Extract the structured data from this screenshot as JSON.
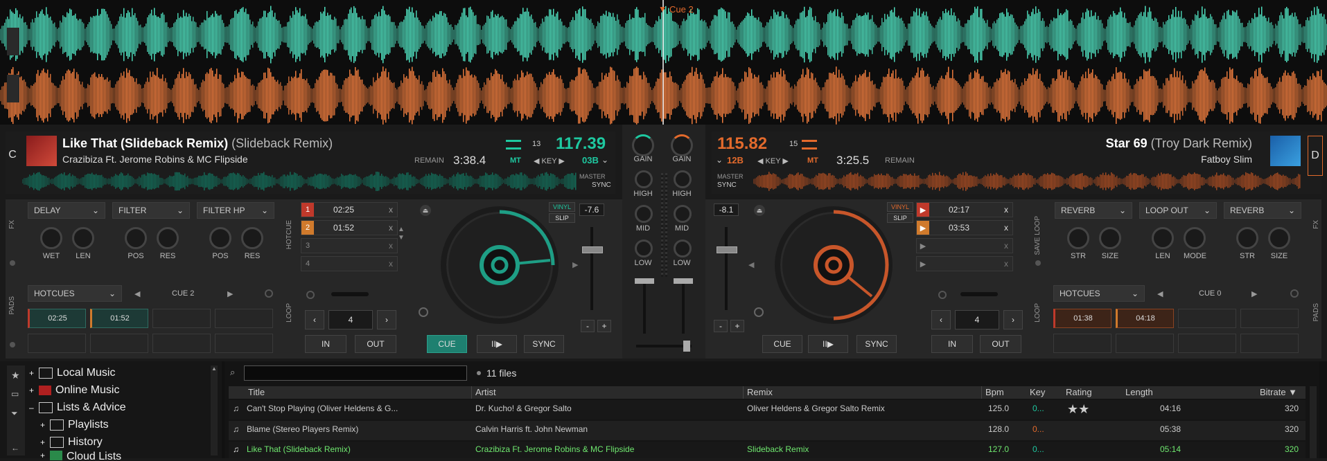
{
  "colors": {
    "deck_a": "#1ec8a0",
    "deck_b": "#e36a2c",
    "wave_a": "#4fe0bf",
    "wave_b": "#f07d3e",
    "green_text": "#6fe86f"
  },
  "waveform": {
    "cue_label": "Cue 2"
  },
  "deck_a": {
    "letter": "C",
    "title": "Like That (Slideback Remix)",
    "title_sub": "(Slideback Remix)",
    "artist": "Crazibiza Ft. Jerome Robins & MC Flipside",
    "pitch_count": "13",
    "bpm": "117.39",
    "remain_label": "REMAIN",
    "remain_time": "3:38.4",
    "mt": "MT",
    "key_label": "KEY",
    "key": "03B",
    "master": "MASTER",
    "sync": "SYNC",
    "pitch_val": "-7.6",
    "vinyl": "VINYL",
    "slip": "SLIP",
    "fx": [
      {
        "name": "DELAY",
        "knobs": [
          "WET",
          "LEN"
        ]
      },
      {
        "name": "FILTER",
        "knobs": [
          "POS",
          "RES"
        ]
      },
      {
        "name": "FILTER HP",
        "knobs": [
          "POS",
          "RES"
        ]
      }
    ],
    "fx_label": "FX",
    "hotcue_label": "HOTCUE",
    "hotcues": [
      {
        "num": "1",
        "time": "02:25",
        "x": "x"
      },
      {
        "num": "2",
        "time": "01:52",
        "x": "x"
      },
      {
        "num": "3",
        "time": "",
        "x": "x"
      },
      {
        "num": "4",
        "time": "",
        "x": "x"
      }
    ],
    "pads_label": "PADS",
    "pads_mode": "HOTCUES",
    "pads_page": "CUE 2",
    "pads": [
      "02:25",
      "01:52",
      "",
      "",
      "",
      "",
      "",
      ""
    ],
    "loop_label": "LOOP",
    "loop_size": "4",
    "loop_in": "IN",
    "loop_out": "OUT",
    "cue": "CUE",
    "play": "II▶",
    "sync_btn": "SYNC"
  },
  "deck_b": {
    "letter": "D",
    "title": "Star 69",
    "title_sub": "(Troy Dark Remix)",
    "artist": "Fatboy Slim",
    "pitch_count": "15",
    "bpm": "115.82",
    "remain_label": "REMAIN",
    "remain_time": "3:25.5",
    "mt": "MT",
    "key_label": "KEY",
    "key": "12B",
    "master": "MASTER",
    "sync": "SYNC",
    "pitch_val": "-8.1",
    "vinyl": "VINYL",
    "slip": "SLIP",
    "fx": [
      {
        "name": "REVERB",
        "knobs": [
          "STR",
          "SIZE"
        ]
      },
      {
        "name": "LOOP OUT",
        "knobs": [
          "LEN",
          "MODE"
        ]
      },
      {
        "name": "REVERB",
        "knobs": [
          "STR",
          "SIZE"
        ]
      }
    ],
    "fx_label": "FX",
    "saveloop_label": "SAVE LOOP",
    "hotcues": [
      {
        "num": "",
        "time": "02:17",
        "x": "x"
      },
      {
        "num": "",
        "time": "03:53",
        "x": "x"
      },
      {
        "num": "",
        "time": "",
        "x": "x"
      },
      {
        "num": "",
        "time": "",
        "x": "x"
      }
    ],
    "pads_label": "PADS",
    "pads_mode": "HOTCUES",
    "pads_page": "CUE 0",
    "pads": [
      "01:38",
      "04:18",
      "",
      "",
      "",
      "",
      "",
      ""
    ],
    "loop_label": "LOOP",
    "loop_size": "4",
    "loop_in": "IN",
    "loop_out": "OUT",
    "cue": "CUE",
    "play": "II▶",
    "sync_btn": "SYNC"
  },
  "mixer": {
    "gain": "GAIN",
    "high": "HIGH",
    "mid": "MID",
    "low": "LOW"
  },
  "browser": {
    "tree": [
      {
        "label": "Local Music",
        "expander": "+"
      },
      {
        "label": "Online Music",
        "expander": "+"
      },
      {
        "label": "Lists & Advice",
        "expander": "–"
      },
      {
        "label": "Playlists",
        "expander": "+"
      },
      {
        "label": "History",
        "expander": "+"
      },
      {
        "label": "Cloud Lists",
        "expander": "+"
      }
    ],
    "search_placeholder": "",
    "file_count": "11 files",
    "columns": {
      "title": "Title",
      "artist": "Artist",
      "remix": "Remix",
      "bpm": "Bpm",
      "key": "Key",
      "rating": "Rating",
      "length": "Length",
      "bitrate": "Bitrate ▼"
    },
    "rows": [
      {
        "title": "Can't Stop Playing (Oliver Heldens & G...",
        "artist": "Dr. Kucho! & Gregor Salto",
        "remix": "Oliver Heldens & Gregor Salto Remix",
        "bpm": "125.0",
        "key": "0...",
        "rating": "★★",
        "length": "04:16",
        "bitrate": "320"
      },
      {
        "title": "Blame (Stereo Players Remix)",
        "artist": "Calvin Harris ft. John Newman",
        "remix": "",
        "bpm": "128.0",
        "key": "0...",
        "rating": "",
        "length": "05:38",
        "bitrate": "320"
      },
      {
        "title": "Like That (Slideback Remix)",
        "artist": "Crazibiza Ft. Jerome Robins & MC Flipside",
        "remix": "Slideback Remix",
        "bpm": "127.0",
        "key": "0...",
        "rating": "",
        "length": "05:14",
        "bitrate": "320"
      }
    ]
  }
}
